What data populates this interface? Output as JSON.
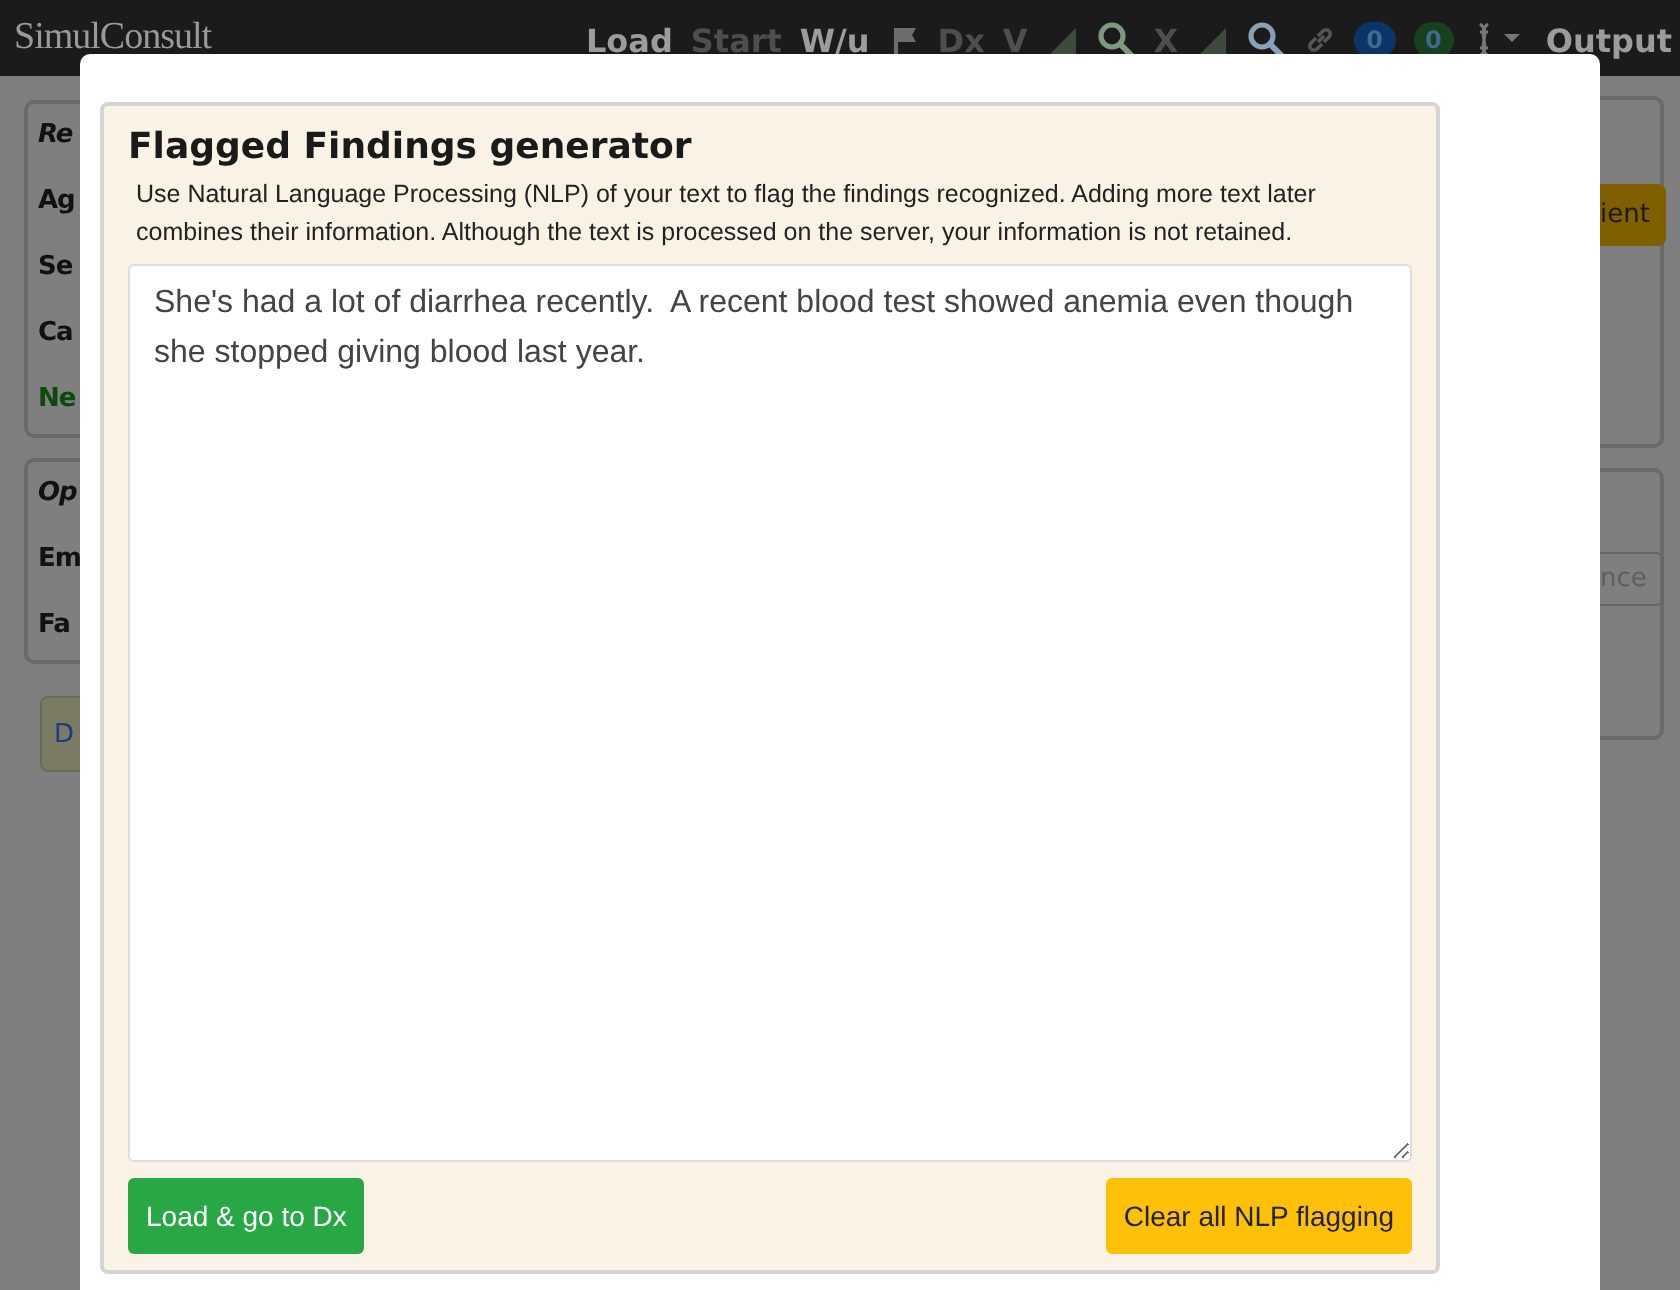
{
  "navbar": {
    "logo": "SimulConsult",
    "items": [
      {
        "kind": "text",
        "label": "Load",
        "disabled": false
      },
      {
        "kind": "text",
        "label": "Start",
        "disabled": true
      },
      {
        "kind": "text",
        "label": "W/u",
        "disabled": false
      },
      {
        "kind": "flag"
      },
      {
        "kind": "text",
        "label": "Dx",
        "disabled": true
      },
      {
        "kind": "text",
        "label": "V",
        "disabled": true
      },
      {
        "kind": "corner"
      },
      {
        "kind": "search",
        "color": "#7e9a7e"
      },
      {
        "kind": "text",
        "label": "X",
        "disabled": true
      },
      {
        "kind": "corner"
      },
      {
        "kind": "search",
        "color": "#8aa0b8"
      },
      {
        "kind": "link"
      },
      {
        "kind": "badge",
        "label": "0",
        "color": "#0b3566"
      },
      {
        "kind": "badge",
        "label": "0",
        "color": "#17401f"
      },
      {
        "kind": "dna"
      },
      {
        "kind": "text",
        "label": "Output",
        "disabled": false
      }
    ]
  },
  "background_page": {
    "left_cards": [
      {
        "title": "Re",
        "rows": [
          {
            "label": "Ag",
            "color": "#111111"
          },
          {
            "label": "Se",
            "color": "#111111"
          },
          {
            "label": "Ca",
            "color": "#111111"
          },
          {
            "label": "Ne",
            "color": "#0b4a0b"
          }
        ]
      },
      {
        "title": "Op",
        "rows": [
          {
            "label": "Em",
            "color": "#111111"
          },
          {
            "label": "Fa",
            "color": "#111111"
          }
        ]
      }
    ],
    "left_button": "D",
    "right_buttons": [
      {
        "label": "ient",
        "kind": "warning"
      },
      {
        "label": "nce",
        "kind": "outline"
      }
    ]
  },
  "dialog": {
    "title": "Flagged Findings generator",
    "description": "Use Natural Language Processing (NLP) of your text to flag the findings recognized. Adding more text later combines their information.  Although the text is processed on the server, your information is not retained.",
    "text": "She's had a lot of diarrhea recently.  A recent blood test showed anemia even though she stopped giving blood last year.",
    "buttons": [
      {
        "label": "Load & go to Dx",
        "kind": "success"
      },
      {
        "label": "Clear all NLP flagging",
        "kind": "warning"
      }
    ]
  }
}
